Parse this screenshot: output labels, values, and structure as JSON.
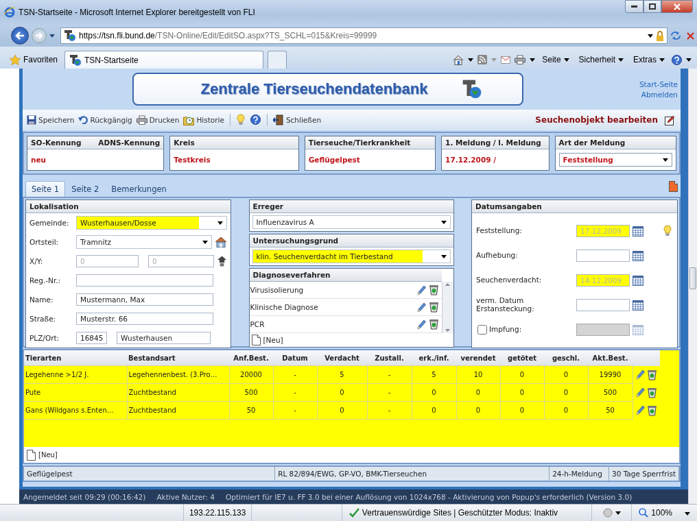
{
  "window": {
    "title": "TSN-Startseite - Microsoft Internet Explorer bereitgestellt von FLI"
  },
  "address_bar": {
    "url_host": "https://tsn.fli.bund.de",
    "url_path": "/TSN-Online/Edit/EditSO.aspx?TS_SCHL=015&Kreis=99999"
  },
  "command_bar": {
    "favorites": "Favoriten",
    "tab": "TSN-Startseite",
    "menus": [
      "Seite",
      "Sicherheit",
      "Extras"
    ]
  },
  "banner": {
    "title": "Zentrale Tierseuchendatenbank",
    "links": [
      "Start-Seite",
      "Abmelden"
    ]
  },
  "toolbar": {
    "items": [
      {
        "kind": "save",
        "label": "Speichern",
        "separator_before": false
      },
      {
        "kind": "undo",
        "label": "Rückgängig",
        "separator_before": false
      },
      {
        "kind": "print",
        "label": "Drucken",
        "separator_before": false
      },
      {
        "kind": "history",
        "label": "Historie",
        "separator_before": false
      },
      {
        "kind": "hint",
        "separator_before": true
      },
      {
        "kind": "help",
        "separator_before": false
      },
      {
        "kind": "close",
        "label": "Schließen",
        "separator_before": true
      }
    ],
    "heading": "Seuchenobjekt bearbeiten"
  },
  "summary": [
    {
      "kind": "text",
      "labels": [
        "SO-Kennung",
        "ADNS-Kennung"
      ],
      "value": "neu"
    },
    {
      "kind": "text",
      "labels": [
        "Kreis"
      ],
      "value": "Testkreis"
    },
    {
      "kind": "text",
      "labels": [
        "Tierseuche/Tierkrankheit"
      ],
      "value": "Geflügelpest"
    },
    {
      "kind": "text",
      "labels": [
        "1. Meldung / l. Meldung"
      ],
      "value": "17.12.2009 /"
    },
    {
      "kind": "select",
      "labels": [
        "Art der Meldung"
      ],
      "value": "Feststellung"
    }
  ],
  "tabs": [
    {
      "label": "Seite 1",
      "selected": true
    },
    {
      "label": "Seite 2",
      "selected": false
    },
    {
      "label": "Bemerkungen",
      "selected": false
    }
  ],
  "lokalisation": {
    "title": "Lokalisation",
    "fields": [
      {
        "kind": "select",
        "label": "Gemeinde:",
        "value": "Wusterhausen/Dosse",
        "highlighted": true
      },
      {
        "kind": "select",
        "label": "Ortsteil:",
        "value": "Tramnitz",
        "highlighted": false,
        "action_button": true
      },
      {
        "kind": "pair",
        "label": "X/Y:",
        "values": [
          "0",
          "0"
        ],
        "disabled": true,
        "action_button": true
      },
      {
        "kind": "text",
        "label": "Reg.-Nr.:"
      },
      {
        "kind": "text",
        "label": "Name:",
        "value": "Mustermann, Max"
      },
      {
        "kind": "text",
        "label": "Straße:",
        "value": "Musterstr. 66"
      },
      {
        "kind": "pair",
        "label": "PLZ/Ort:",
        "values": [
          "16845",
          "Wusterhausen"
        ],
        "disabled": false
      }
    ]
  },
  "erreger": {
    "title": "Erreger",
    "value": "Influenzavirus A",
    "highlighted": false
  },
  "untersuchungsgrund": {
    "title": "Untersuchungsgrund",
    "value": "klin. Seuchenverdacht im Tierbestand",
    "highlighted": true
  },
  "diagnoseverfahren": {
    "title": "Diagnoseverfahren",
    "items": [
      "Virusisolierung",
      "Klinische Diagnose",
      "PCR"
    ],
    "new_label": "[Neu]"
  },
  "datumsangaben": {
    "title": "Datumsangaben",
    "fields": [
      {
        "kind": "date",
        "label": "Feststellung:",
        "value": "17.12.2009",
        "highlighted": true,
        "hint": true
      },
      {
        "kind": "date",
        "label": "Aufhebung:",
        "highlighted": false,
        "hint": false
      },
      {
        "kind": "date",
        "label": "Seuchenverdacht:",
        "value": "14.12.2009",
        "highlighted": true,
        "hint": false
      },
      {
        "kind": "date",
        "label": "verm. Datum Erstansteckung:",
        "highlighted": false,
        "hint": false
      },
      {
        "kind": "checkbox",
        "label": "Impfung:",
        "checked": false,
        "disabled": true,
        "hint": false
      }
    ]
  },
  "tierarten": {
    "columns": [
      "Tierarten",
      "Bestandsart",
      "Anf.Best.",
      "Datum",
      "Verdacht",
      "Zustall.",
      "erk./inf.",
      "verendet",
      "getötet",
      "geschl.",
      "Akt.Best."
    ],
    "rows": [
      [
        "Legehenne >1/2 J.",
        "Legehennenbest. (3.Pro…",
        "20000",
        "-",
        "5",
        "-",
        "5",
        "10",
        "0",
        "0",
        "19990"
      ],
      [
        "Pute",
        "Zuchtbestand",
        "500",
        "-",
        "0",
        "-",
        "0",
        "0",
        "0",
        "0",
        "500"
      ],
      [
        "Gans (Wildgans s.Enten…",
        "Zuchtbestand",
        "50",
        "-",
        "0",
        "-",
        "0",
        "0",
        "0",
        "0",
        "50"
      ]
    ],
    "new_label": "[Neu]"
  },
  "footer": [
    "Geflügelpest",
    "RL 82/894/EWG, GP-VO, BMK-Tierseuchen",
    "24-h-Meldung",
    "30 Tage Sperrfrist"
  ],
  "app_status": [
    "Angemeldet seit 09:29 (00:16:42)",
    "Aktive Nutzer: 4",
    "Optimiert für IE7 u. FF 3.0 bei einer Auflösung von 1024x768 - Aktivierung von Popup's erforderlich (Version 3.0)"
  ],
  "status_bar": {
    "ip": "193.22.115.133",
    "zone": "Vertrauenswürdige Sites | Geschützter Modus: Inaktiv",
    "zoom": "100%"
  }
}
